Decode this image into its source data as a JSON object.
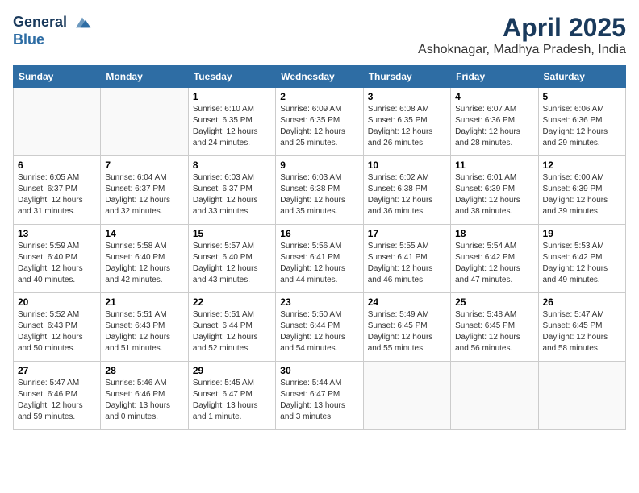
{
  "header": {
    "logo_line1": "General",
    "logo_line2": "Blue",
    "month": "April 2025",
    "location": "Ashoknagar, Madhya Pradesh, India"
  },
  "weekdays": [
    "Sunday",
    "Monday",
    "Tuesday",
    "Wednesday",
    "Thursday",
    "Friday",
    "Saturday"
  ],
  "weeks": [
    [
      {
        "day": "",
        "info": ""
      },
      {
        "day": "",
        "info": ""
      },
      {
        "day": "1",
        "info": "Sunrise: 6:10 AM\nSunset: 6:35 PM\nDaylight: 12 hours and 24 minutes."
      },
      {
        "day": "2",
        "info": "Sunrise: 6:09 AM\nSunset: 6:35 PM\nDaylight: 12 hours and 25 minutes."
      },
      {
        "day": "3",
        "info": "Sunrise: 6:08 AM\nSunset: 6:35 PM\nDaylight: 12 hours and 26 minutes."
      },
      {
        "day": "4",
        "info": "Sunrise: 6:07 AM\nSunset: 6:36 PM\nDaylight: 12 hours and 28 minutes."
      },
      {
        "day": "5",
        "info": "Sunrise: 6:06 AM\nSunset: 6:36 PM\nDaylight: 12 hours and 29 minutes."
      }
    ],
    [
      {
        "day": "6",
        "info": "Sunrise: 6:05 AM\nSunset: 6:37 PM\nDaylight: 12 hours and 31 minutes."
      },
      {
        "day": "7",
        "info": "Sunrise: 6:04 AM\nSunset: 6:37 PM\nDaylight: 12 hours and 32 minutes."
      },
      {
        "day": "8",
        "info": "Sunrise: 6:03 AM\nSunset: 6:37 PM\nDaylight: 12 hours and 33 minutes."
      },
      {
        "day": "9",
        "info": "Sunrise: 6:03 AM\nSunset: 6:38 PM\nDaylight: 12 hours and 35 minutes."
      },
      {
        "day": "10",
        "info": "Sunrise: 6:02 AM\nSunset: 6:38 PM\nDaylight: 12 hours and 36 minutes."
      },
      {
        "day": "11",
        "info": "Sunrise: 6:01 AM\nSunset: 6:39 PM\nDaylight: 12 hours and 38 minutes."
      },
      {
        "day": "12",
        "info": "Sunrise: 6:00 AM\nSunset: 6:39 PM\nDaylight: 12 hours and 39 minutes."
      }
    ],
    [
      {
        "day": "13",
        "info": "Sunrise: 5:59 AM\nSunset: 6:40 PM\nDaylight: 12 hours and 40 minutes."
      },
      {
        "day": "14",
        "info": "Sunrise: 5:58 AM\nSunset: 6:40 PM\nDaylight: 12 hours and 42 minutes."
      },
      {
        "day": "15",
        "info": "Sunrise: 5:57 AM\nSunset: 6:40 PM\nDaylight: 12 hours and 43 minutes."
      },
      {
        "day": "16",
        "info": "Sunrise: 5:56 AM\nSunset: 6:41 PM\nDaylight: 12 hours and 44 minutes."
      },
      {
        "day": "17",
        "info": "Sunrise: 5:55 AM\nSunset: 6:41 PM\nDaylight: 12 hours and 46 minutes."
      },
      {
        "day": "18",
        "info": "Sunrise: 5:54 AM\nSunset: 6:42 PM\nDaylight: 12 hours and 47 minutes."
      },
      {
        "day": "19",
        "info": "Sunrise: 5:53 AM\nSunset: 6:42 PM\nDaylight: 12 hours and 49 minutes."
      }
    ],
    [
      {
        "day": "20",
        "info": "Sunrise: 5:52 AM\nSunset: 6:43 PM\nDaylight: 12 hours and 50 minutes."
      },
      {
        "day": "21",
        "info": "Sunrise: 5:51 AM\nSunset: 6:43 PM\nDaylight: 12 hours and 51 minutes."
      },
      {
        "day": "22",
        "info": "Sunrise: 5:51 AM\nSunset: 6:44 PM\nDaylight: 12 hours and 52 minutes."
      },
      {
        "day": "23",
        "info": "Sunrise: 5:50 AM\nSunset: 6:44 PM\nDaylight: 12 hours and 54 minutes."
      },
      {
        "day": "24",
        "info": "Sunrise: 5:49 AM\nSunset: 6:45 PM\nDaylight: 12 hours and 55 minutes."
      },
      {
        "day": "25",
        "info": "Sunrise: 5:48 AM\nSunset: 6:45 PM\nDaylight: 12 hours and 56 minutes."
      },
      {
        "day": "26",
        "info": "Sunrise: 5:47 AM\nSunset: 6:45 PM\nDaylight: 12 hours and 58 minutes."
      }
    ],
    [
      {
        "day": "27",
        "info": "Sunrise: 5:47 AM\nSunset: 6:46 PM\nDaylight: 12 hours and 59 minutes."
      },
      {
        "day": "28",
        "info": "Sunrise: 5:46 AM\nSunset: 6:46 PM\nDaylight: 13 hours and 0 minutes."
      },
      {
        "day": "29",
        "info": "Sunrise: 5:45 AM\nSunset: 6:47 PM\nDaylight: 13 hours and 1 minute."
      },
      {
        "day": "30",
        "info": "Sunrise: 5:44 AM\nSunset: 6:47 PM\nDaylight: 13 hours and 3 minutes."
      },
      {
        "day": "",
        "info": ""
      },
      {
        "day": "",
        "info": ""
      },
      {
        "day": "",
        "info": ""
      }
    ]
  ]
}
